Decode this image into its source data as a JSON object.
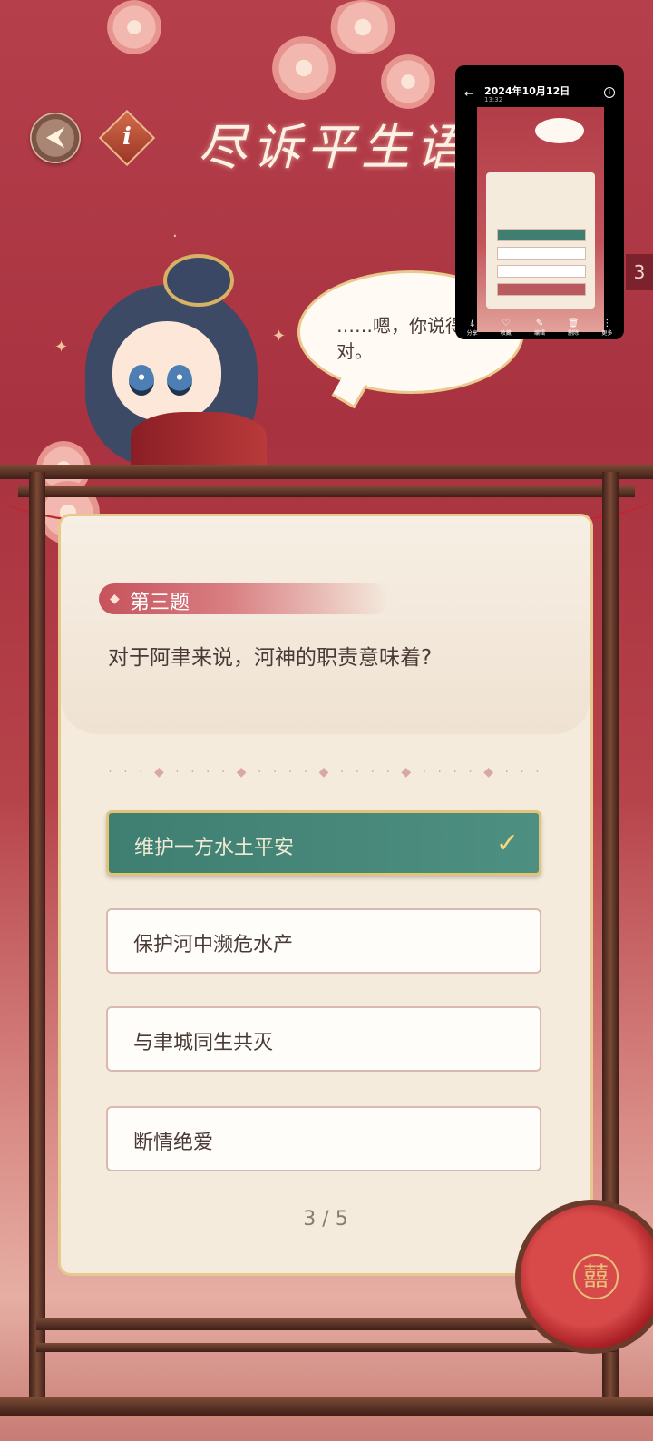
{
  "header": {
    "back_icon_glyph": "⮜",
    "info_icon_glyph": "i",
    "title": "尽诉平生语"
  },
  "character": {
    "speech": "……嗯，你说得对。"
  },
  "quiz": {
    "label": "第三题",
    "label_deco": "◆",
    "question": "对于阿聿来说，河神的职责意味着?",
    "divider": "·  ·  ·  ◆  ·  ·  ·  ·  ◆  ·  ·  ·  ·  ◆  ·  ·  ·  ·  ◆  ·  ·  ·  ·  ◆  ·  ·  ·",
    "options": [
      {
        "label": "维护一方水土平安",
        "selected": true,
        "check": "✓"
      },
      {
        "label": "保护河中濒危水产",
        "selected": false
      },
      {
        "label": "与聿城同生共灭",
        "selected": false
      },
      {
        "label": "断情绝爱",
        "selected": false
      }
    ],
    "progress": "3 / 5"
  },
  "lantern": {
    "glyph": "囍"
  },
  "thumbnail": {
    "date": "2024年10月12日",
    "time": "13:32",
    "back": "←",
    "info": "i",
    "toolbar": [
      {
        "icon": "share-icon",
        "glyph": "⍋",
        "label": "分享"
      },
      {
        "icon": "heart-icon",
        "glyph": "♡",
        "label": "收藏"
      },
      {
        "icon": "edit-icon",
        "glyph": "✎",
        "label": "编辑"
      },
      {
        "icon": "trash-icon",
        "glyph": "🗑",
        "label": "删除"
      },
      {
        "icon": "more-icon",
        "glyph": "⋮",
        "label": "更多"
      }
    ]
  },
  "side_tab": "3",
  "colors": {
    "bg_top": "#b5404c",
    "bg_bottom": "#e6aea4",
    "panel": "#f5ebdd",
    "selected_option": "#3f7f72",
    "gold": "#e0c47a"
  }
}
